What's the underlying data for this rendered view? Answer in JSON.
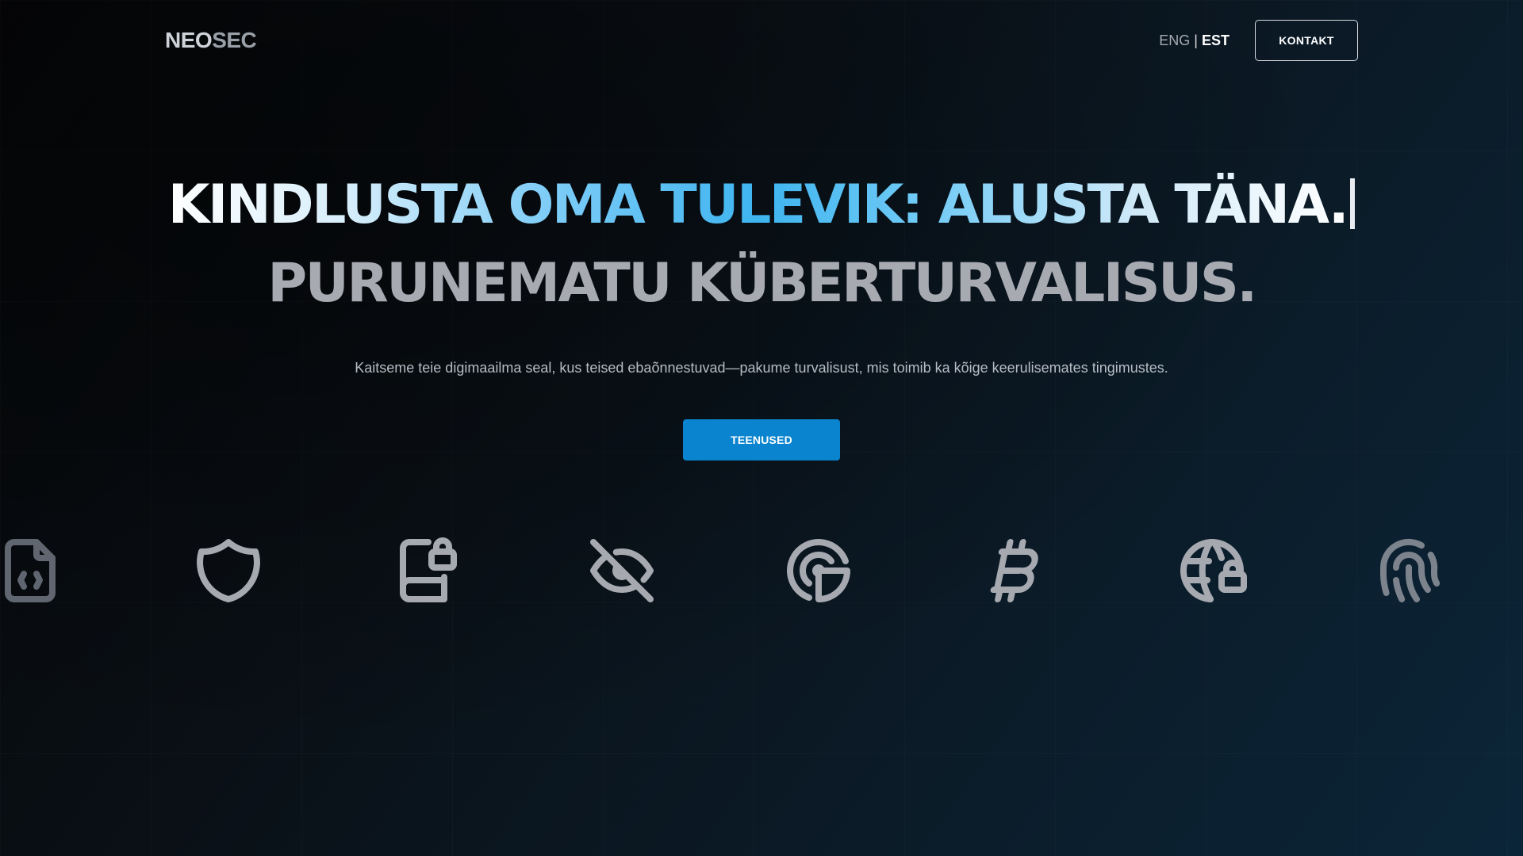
{
  "brand": {
    "logo_part1": "NEO",
    "logo_part2": "SEC"
  },
  "nav": {
    "lang_eng": "ENG",
    "lang_separator": "|",
    "lang_est": "EST",
    "contact_label": "KONTAKT"
  },
  "hero": {
    "headline_line1": "KINDLUSTA OMA TULEVIK: ALUSTA TÄNA.",
    "headline_line2": "PURUNEMATU KÜBERTURVALISUS.",
    "subtitle": "Kaitseme teie digimaailma seal, kus teised ebaõnnestuvad—pakume turvalisust, mis toimib ka kõige keerulisemates tingimustes.",
    "cta_label": "TEENUSED"
  },
  "icons": [
    "document-code-icon",
    "shield-icon",
    "book-lock-icon",
    "eye-off-icon",
    "radar-icon",
    "bitcoin-icon",
    "globe-lock-icon",
    "fingerprint-icon"
  ],
  "colors": {
    "cta_bg": "#0a84cf",
    "headline_accent": "#3eb4ef",
    "headline_secondary": "#a8aab2"
  }
}
